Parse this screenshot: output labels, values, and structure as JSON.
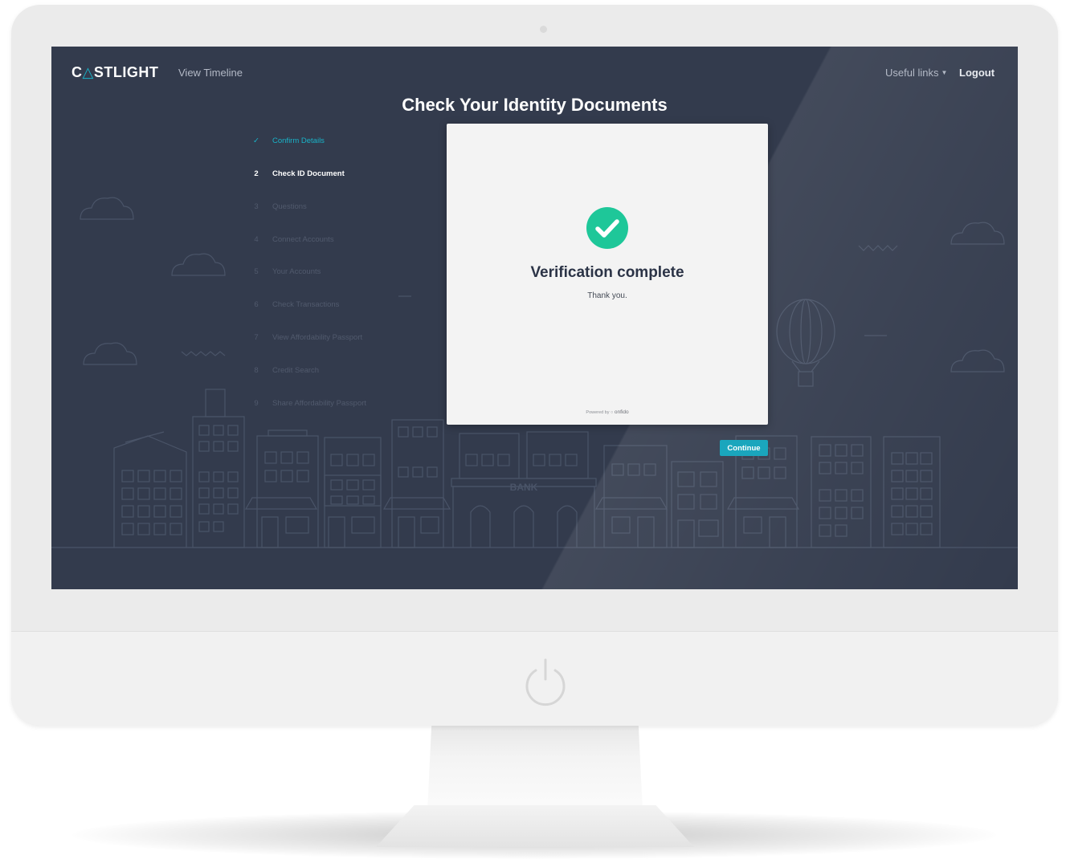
{
  "header": {
    "logo_text": "CASTLIGHT",
    "nav_timeline": "View Timeline",
    "useful_links": "Useful links",
    "logout": "Logout"
  },
  "page": {
    "title": "Check Your Identity Documents"
  },
  "steps": [
    {
      "num": "✓",
      "label": "Confirm Details",
      "state": "done"
    },
    {
      "num": "2",
      "label": "Check ID Document",
      "state": "active"
    },
    {
      "num": "3",
      "label": "Questions",
      "state": "pending"
    },
    {
      "num": "4",
      "label": "Connect Accounts",
      "state": "pending"
    },
    {
      "num": "5",
      "label": "Your Accounts",
      "state": "pending"
    },
    {
      "num": "6",
      "label": "Check Transactions",
      "state": "pending"
    },
    {
      "num": "7",
      "label": "View Affordability Passport",
      "state": "pending"
    },
    {
      "num": "8",
      "label": "Credit Search",
      "state": "pending"
    },
    {
      "num": "9",
      "label": "Share Affordability Passport",
      "state": "pending"
    }
  ],
  "card": {
    "heading": "Verification complete",
    "subtext": "Thank you.",
    "powered_by": "Powered by",
    "powered_brand": "onfido"
  },
  "continue_label": "Continue",
  "scenery": {
    "bank_sign": "BANK"
  },
  "colors": {
    "screen_bg": "#333b4d",
    "accent": "#19b3c8",
    "success": "#1ec799",
    "line_art": "#4a5468"
  },
  "icons": {
    "check": "check-circle-icon",
    "power": "power-icon",
    "caret": "caret-down-icon"
  }
}
